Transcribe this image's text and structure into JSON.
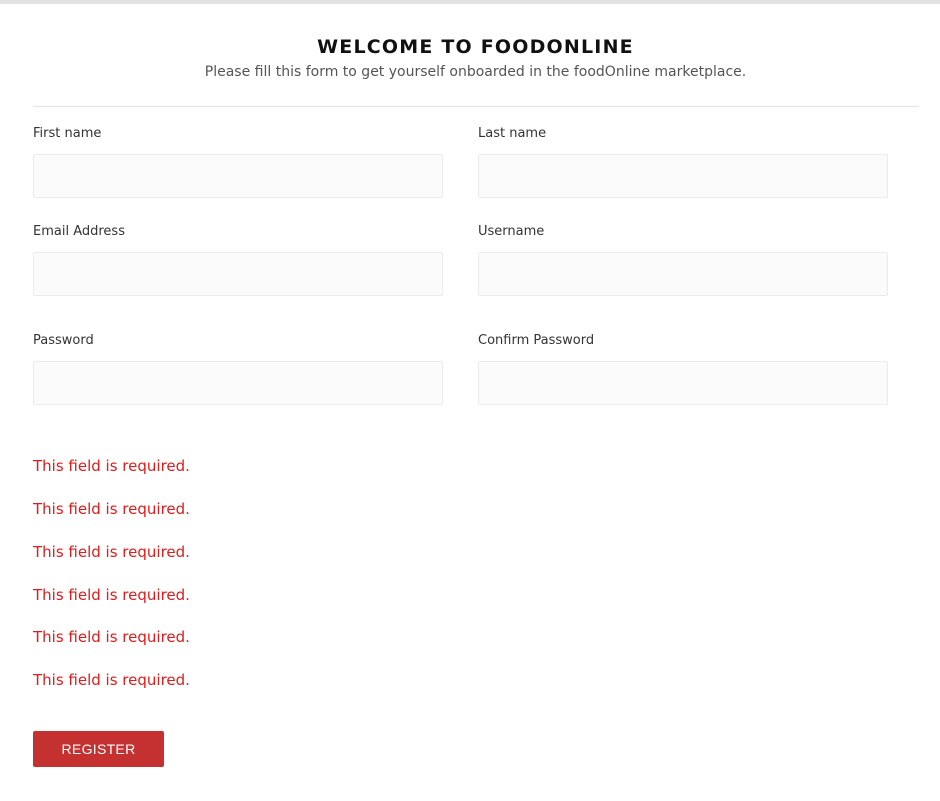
{
  "header": {
    "title": "WELCOME TO FOODONLINE",
    "subtitle": "Please fill this form to get yourself onboarded in the foodOnline marketplace."
  },
  "form": {
    "first_name": {
      "label": "First name",
      "value": ""
    },
    "last_name": {
      "label": "Last name",
      "value": ""
    },
    "email": {
      "label": "Email Address",
      "value": ""
    },
    "username": {
      "label": "Username",
      "value": ""
    },
    "password": {
      "label": "Password",
      "value": ""
    },
    "confirm_password": {
      "label": "Confirm Password",
      "value": ""
    }
  },
  "errors": [
    "This field is required.",
    "This field is required.",
    "This field is required.",
    "This field is required.",
    "This field is required.",
    "This field is required."
  ],
  "register_label": "REGISTER",
  "colors": {
    "error": "#e01b1b",
    "button": "#c53030"
  }
}
